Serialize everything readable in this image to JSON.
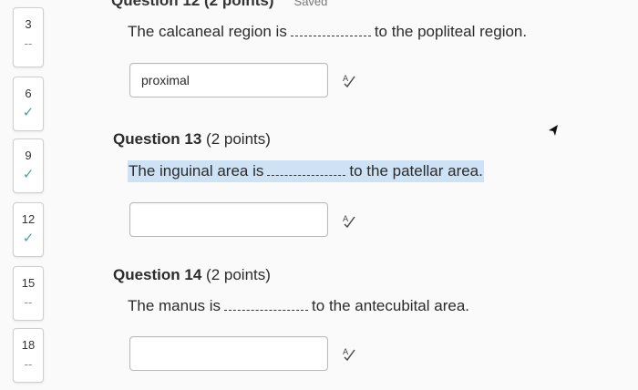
{
  "header": {
    "question_title_partial": "Question 12 (2 points)",
    "saved_label": "Saved"
  },
  "nav": [
    {
      "number": "3",
      "status": "--",
      "answered": false
    },
    {
      "number": "6",
      "status": "✓",
      "answered": true
    },
    {
      "number": "9",
      "status": "✓",
      "answered": true
    },
    {
      "number": "12",
      "status": "✓",
      "answered": true
    },
    {
      "number": "15",
      "status": "--",
      "answered": false
    },
    {
      "number": "18",
      "status": "--",
      "answered": false
    }
  ],
  "q12": {
    "prompt_before": "The calcaneal region is",
    "prompt_after": "to the popliteal region.",
    "answer": "proximal"
  },
  "q13": {
    "label": "Question 13",
    "points": "(2 points)",
    "prompt_before": "The inguinal area is",
    "prompt_after": "to the patellar area.",
    "answer": ""
  },
  "q14": {
    "label": "Question 14",
    "points": "(2 points)",
    "prompt_before": "The manus is",
    "prompt_after": "to the antecubital area.",
    "answer": ""
  },
  "icons": {
    "spellcheck": "spellcheck-icon",
    "cursor": "mouse-cursor-icon"
  }
}
